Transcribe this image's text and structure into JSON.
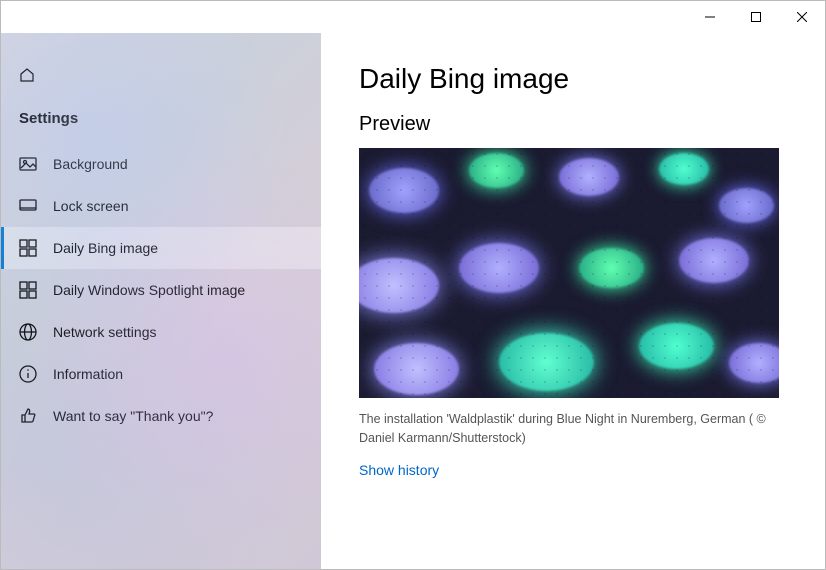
{
  "window": {
    "minimize_tooltip": "Minimize",
    "maximize_tooltip": "Maximize",
    "close_tooltip": "Close"
  },
  "sidebar": {
    "header": "Settings",
    "items": [
      {
        "label": "Background"
      },
      {
        "label": "Lock screen"
      },
      {
        "label": "Daily Bing image"
      },
      {
        "label": "Daily Windows Spotlight image"
      },
      {
        "label": "Network settings"
      },
      {
        "label": "Information"
      },
      {
        "label": "Want to say \"Thank you\"?"
      }
    ],
    "selected_index": 2
  },
  "main": {
    "title": "Daily Bing image",
    "preview_heading": "Preview",
    "caption": "The installation 'Waldplastik' during Blue Night in Nuremberg, German ( © Daniel Karmann/Shutterstock)",
    "history_link": "Show history"
  }
}
